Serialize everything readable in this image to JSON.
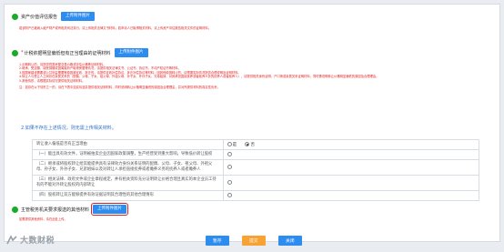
{
  "sections": {
    "asset_report": {
      "label": "资产价值评估报告",
      "upload_label": "上传附件图片",
      "note": "若该财产已被纳入破产财产或有相关司法执行，请上传相关法律文书材料；若申请人已取得相关材料，请上传资产评估报告相关文件的证明材料。"
    },
    "income_proof": {
      "label": "计税依据明显偏低但有正当理由的证明材料",
      "upload_label": "上传附件图片",
      "notes": [
        "1.近期转让的，请提供同类房屋交易价格或评估价格等证明材料。",
        "2.继承、受遗赠、接受捐赠或因离婚析产取得房屋等情况，请提供相关法律文书、公证书、协议书、不动产权证书等材料。",
        "3.因国家建设需要或公共利益需要等原因被征收、拆迁的，请提供征收补偿协议、拆迁补偿协议等材料；因其他原因转让的，请根据实际情况提供合理说明及证明材料。",
        "4.转让人与受让人之间存在亲属关系的（配偶、父母、子女、祖父母、外祖父母、孙子女、外孙子女、兄弟姐妹、对其承担直接抚养或者赡养义务的抚养人或者赡养人），请提供相关身份证明、户口簿或亲属关系证明材料，同时需说明转让价格明显偏低的原因及合理理由。",
        "5.其他情形，请根据实际情况提供相关证明材料。"
      ],
      "sub_note": "注：如存在以下情形之一的，请在下表中如实勾选并提供相关证明材料，同时说明转让价格明显偏低的原因及合理理由，并对所提供材料的真实性负责。"
    },
    "exempt": {
      "label": "主管税务机关要求报送的其他材料",
      "upload_label": "上传附件图片",
      "note": "如需提供其他资料，请在此处上传。"
    }
  },
  "blue_text": "2.如果不存在上述情况，则无需上传相关材料。",
  "question_table": {
    "rows": [
      {
        "question": "转让收入偏低是否有正当理由",
        "options": [
          "是",
          "否"
        ],
        "selected": 1
      },
      {
        "question": "（一）能出具有效文件，证明被拍卖企业因国家政策调整，生产经营受到重大影响，导致低价转让股权",
        "options": [],
        "selected": -1
      },
      {
        "question": "（二）继承或将股权转让给其能提供具有法律效力身份关系证明的配偶、父母、子女、祖父母、外祖父母、孙子女、外孙子女、兄弟姐妹以及对转让人承担直接抚养或者赡养义务的抚养人或者赡养人",
        "options": [],
        "selected": -1
      },
      {
        "question": "（三）相关法律、政府文件或企业章程规定，并有相关资料充分证明转让价格合理且真实的本企业员工持有的不能对外转让股权的内部转让",
        "options": [],
        "selected": -1
      },
      {
        "question": "（四）股权转让双方能够提供有效证据证明其合理性的其他合理情形",
        "options": [],
        "selected": -1
      }
    ]
  },
  "footer": {
    "save_label": "暂存",
    "submit_label": "提交",
    "close_label": "关闭"
  },
  "logo_text": "大数财税",
  "colors": {
    "accent": "#2d8cf0",
    "success": "#1aab2a",
    "danger": "#e02020",
    "warning": "#f7a233"
  }
}
